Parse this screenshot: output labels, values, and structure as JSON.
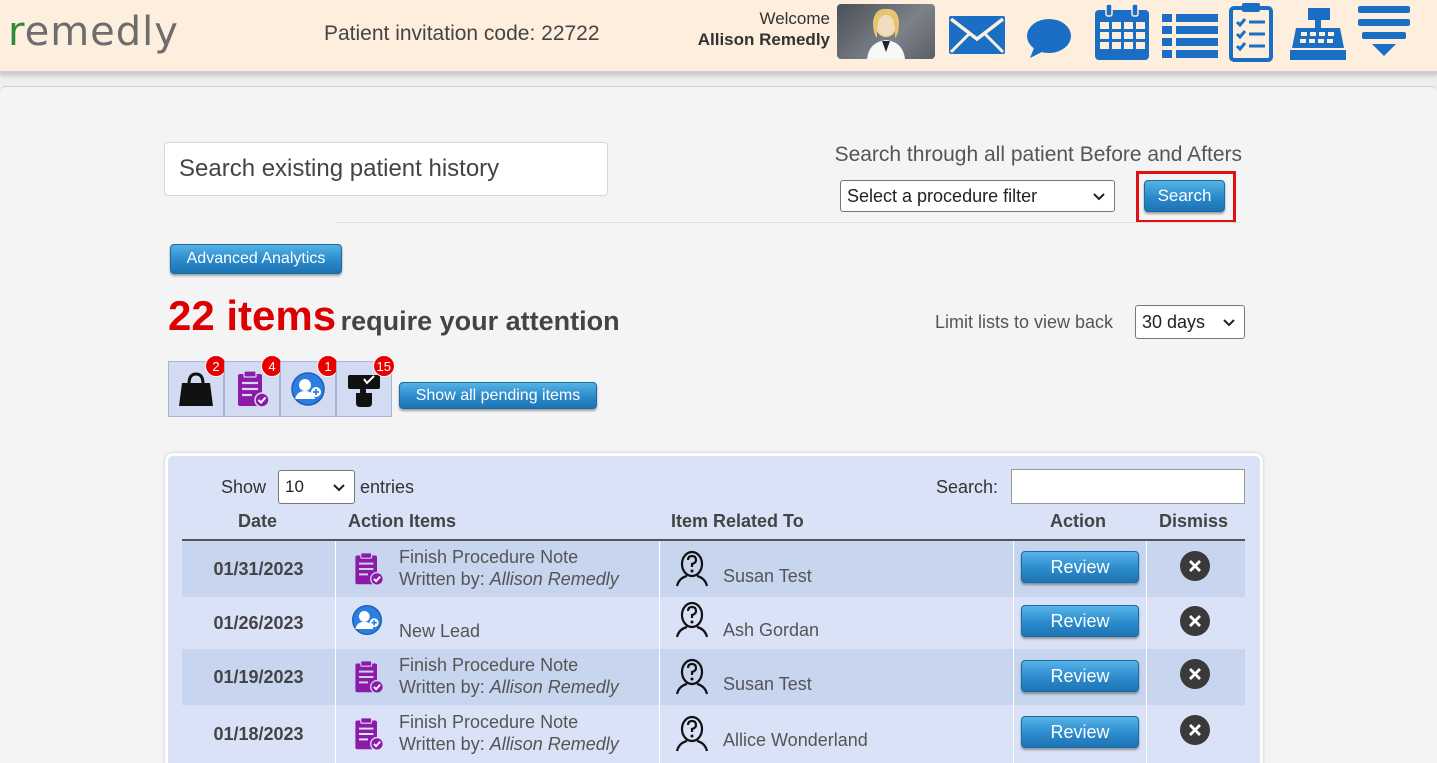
{
  "header": {
    "logo_prefix": "r",
    "logo_rest": "emedly",
    "invite_text": "Patient invitation code: 22722",
    "welcome_label": "Welcome",
    "user_name": "Allison Remedly",
    "icons": [
      "mail-icon",
      "chat-icon",
      "calendar-icon",
      "list-icon",
      "checklist-icon",
      "register-icon",
      "menu-icon"
    ]
  },
  "search": {
    "history_placeholder": "Search existing patient history",
    "ba_title": "Search through all patient Before and Afters",
    "procedure_filter": "Select a procedure filter",
    "search_button": "Search"
  },
  "advanced_analytics": "Advanced Analytics",
  "attention": {
    "count_text": "22 items",
    "rest_text": "require your attention"
  },
  "limit": {
    "label": "Limit lists to view back",
    "value": "30 days"
  },
  "categories": [
    {
      "name": "bag",
      "badge": "2"
    },
    {
      "name": "clipboard",
      "badge": "4"
    },
    {
      "name": "lead",
      "badge": "1"
    },
    {
      "name": "sign",
      "badge": "15"
    }
  ],
  "show_all_pending": "Show all pending items",
  "table": {
    "show_label": "Show",
    "show_value": "10",
    "entries_label": "entries",
    "search_label": "Search:",
    "search_value": "",
    "headers": {
      "date": "Date",
      "action_items": "Action Items",
      "related": "Item Related To",
      "action": "Action",
      "dismiss": "Dismiss"
    },
    "review_label": "Review",
    "rows": [
      {
        "date": "01/31/2023",
        "type": "procedure",
        "title": "Finish Procedure Note",
        "written_by": "Written by: ",
        "writer": "Allison Remedly",
        "related": "Susan Test"
      },
      {
        "date": "01/26/2023",
        "type": "lead",
        "title": "New Lead",
        "written_by": "",
        "writer": "",
        "related": "Ash Gordan"
      },
      {
        "date": "01/19/2023",
        "type": "procedure",
        "title": "Finish Procedure Note",
        "written_by": "Written by: ",
        "writer": "Allison Remedly",
        "related": "Susan Test"
      },
      {
        "date": "01/18/2023",
        "type": "procedure",
        "title": "Finish Procedure Note",
        "written_by": "Written by: ",
        "writer": "Allison Remedly",
        "related": "Allice Wonderland"
      }
    ]
  },
  "colors": {
    "accent_blue": "#2a8acb",
    "alert_red": "#dd0000",
    "icon_blue": "#1a6fc4",
    "icon_purple": "#8e1aa8"
  }
}
